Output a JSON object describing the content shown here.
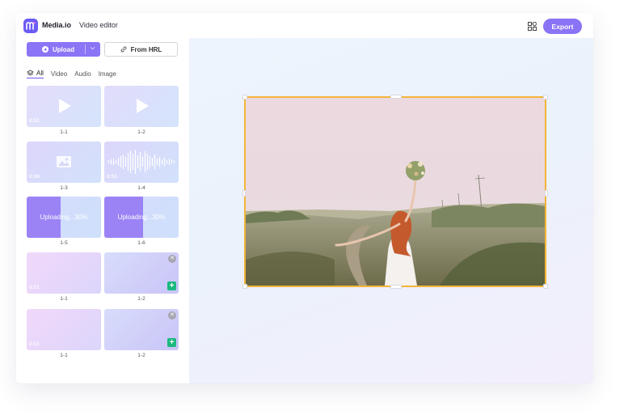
{
  "app": {
    "brand": "Media.io",
    "title": "Video editor",
    "export_label": "Export"
  },
  "toolbar": {
    "upload_label": "Upload",
    "from_url_label": "From HRL"
  },
  "tabs": [
    {
      "label": "All",
      "active": true
    },
    {
      "label": "Video",
      "active": false
    },
    {
      "label": "Audio",
      "active": false
    },
    {
      "label": "Image",
      "active": false
    }
  ],
  "media": [
    {
      "caption": "1-1",
      "duration": "0:51",
      "kind": "video"
    },
    {
      "caption": "1-2",
      "duration": "",
      "kind": "video"
    },
    {
      "caption": "1-3",
      "duration": "0:36",
      "kind": "image"
    },
    {
      "caption": "1-4",
      "duration": "0:51",
      "kind": "audio"
    },
    {
      "caption": "1-5",
      "status": "Uploading...30%",
      "progress": 0.46
    },
    {
      "caption": "1-6",
      "status": "Uploading...30%",
      "progress": 0.52
    },
    {
      "caption": "1-1",
      "duration": "0:51"
    },
    {
      "caption": "1-2",
      "duration": ""
    },
    {
      "caption": "1-1",
      "duration": "0:51"
    },
    {
      "caption": "1-2",
      "duration": ""
    }
  ],
  "colors": {
    "accent": "#8b74f6",
    "selection": "#f4b43a",
    "add": "#1cb97e"
  },
  "preview": {
    "subject": "woman in white dress holding flowers in a field"
  }
}
